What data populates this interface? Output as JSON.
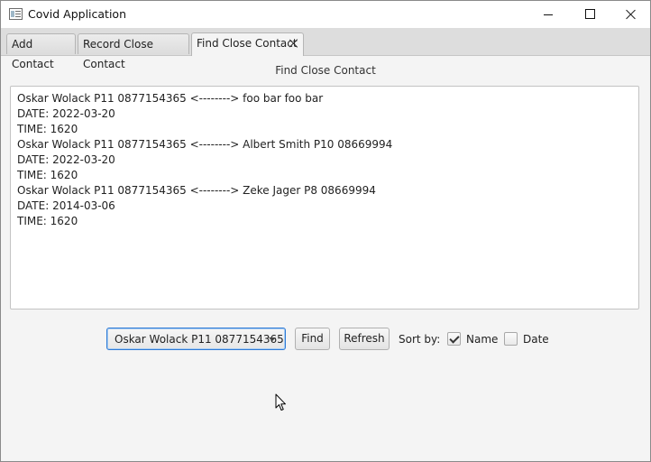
{
  "window": {
    "title": "Covid Application"
  },
  "tabs": [
    {
      "label": "Add Contact",
      "active": false
    },
    {
      "label": "Record Close Contact",
      "active": false
    },
    {
      "label": "Find Close Contact",
      "active": true
    }
  ],
  "main": {
    "section_title": "Find Close Contact",
    "results": [
      "Oskar Wolack P11 0877154365 <--------> foo bar foo bar",
      "DATE: 2022-03-20",
      "TIME: 1620",
      "Oskar Wolack P11 0877154365 <--------> Albert Smith P10 08669994",
      "DATE: 2022-03-20",
      "TIME: 1620",
      "Oskar Wolack P11 0877154365 <--------> Zeke Jager P8 08669994",
      "DATE: 2014-03-06",
      "TIME: 1620"
    ]
  },
  "controls": {
    "person_select": {
      "selected": "Oskar Wolack P11 0877154365"
    },
    "find_label": "Find",
    "refresh_label": "Refresh",
    "sort_label": "Sort by:",
    "sort_options": [
      {
        "label": "Name",
        "checked": true
      },
      {
        "label": "Date",
        "checked": false
      }
    ]
  },
  "colors": {
    "focus_accent": "#2f7bd6",
    "tab_bar": "#dddddd",
    "window_bg": "#f4f4f4"
  },
  "icons": {
    "app": "app-window-icon",
    "minimize": "minimize-icon",
    "maximize": "maximize-icon",
    "close": "close-icon",
    "tab_close": "close-icon",
    "dropdown": "chevron-down-icon",
    "cursor": "mouse-pointer-icon"
  }
}
